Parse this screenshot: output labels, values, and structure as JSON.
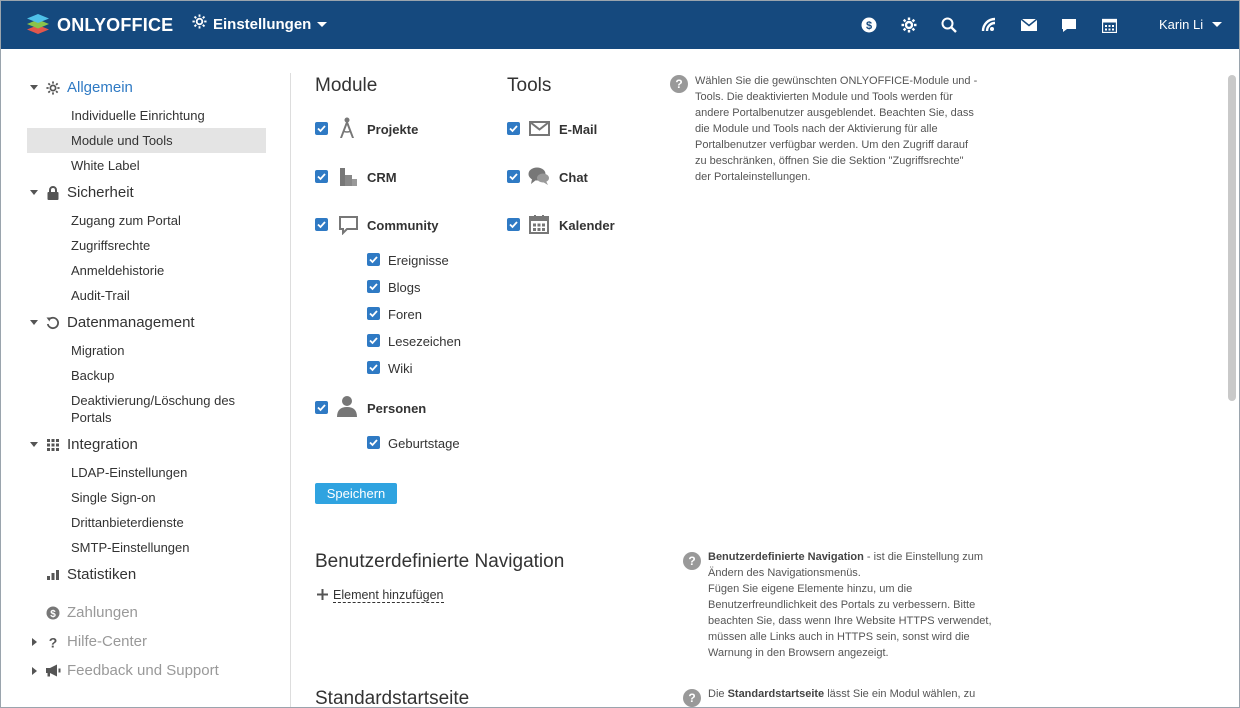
{
  "header": {
    "logo_text": "ONLYOFFICE",
    "module_label": "Einstellungen",
    "user_name": "Karin Li",
    "icons": [
      "payments-icon",
      "settings-icon",
      "search-icon",
      "feed-icon",
      "mail-icon",
      "chat-icon",
      "calendar-icon"
    ],
    "bg_color": "#15497e"
  },
  "sidebar": {
    "sections": {
      "allgemein": "Allgemein",
      "sicherheit": "Sicherheit",
      "datenmanagement": "Datenmanagement",
      "integration": "Integration",
      "statistiken": "Statistiken",
      "zahlungen": "Zahlungen",
      "hilfe": "Hilfe-Center",
      "feedback": "Feedback und Support"
    },
    "allgemein_items": [
      "Individuelle Einrichtung",
      "Module und Tools",
      "White Label"
    ],
    "sicherheit_items": [
      "Zugang zum Portal",
      "Zugriffsrechte",
      "Anmeldehistorie",
      "Audit-Trail"
    ],
    "datenmanagement_items": [
      "Migration",
      "Backup",
      "Deaktivierung/Löschung des",
      "Portals"
    ],
    "integration_items": [
      "LDAP-Einstellungen",
      "Single Sign-on",
      "Drittanbieterdienste",
      "SMTP-Einstellungen"
    ],
    "active_item": "Module und Tools",
    "accent_color": "#2f7ac4"
  },
  "main": {
    "modules_title": "Module",
    "tools_title": "Tools",
    "modules": {
      "projekte": "Projekte",
      "crm": "CRM",
      "community": "Community",
      "personen": "Personen"
    },
    "community_subs": [
      "Ereignisse",
      "Blogs",
      "Foren",
      "Lesezeichen",
      "Wiki"
    ],
    "personen_subs": [
      "Geburtstage"
    ],
    "tools": {
      "email": "E-Mail",
      "chat": "Chat",
      "kalender": "Kalender"
    },
    "save_label": "Speichern",
    "help_modules": [
      "Wählen Sie die gewünschten ONLYOFFICE-Module und -",
      "Tools. Die deaktivierten Module und Tools werden für",
      "andere Portalbenutzer ausgeblendet. Beachten Sie, dass",
      "die Module und Tools nach der Aktivierung für alle",
      "Portalbenutzer verfügbar werden. Um den Zugriff darauf",
      "zu beschränken, öffnen Sie die Sektion \"Zugriffsrechte\"",
      "der Portaleinstellungen."
    ],
    "nav_title": "Benutzerdefinierte Navigation",
    "add_element": "Element hinzufügen",
    "help_nav_bold": "Benutzerdefinierte Navigation",
    "help_nav_rest": " - ist die Einstellung zum",
    "help_nav_lines": [
      "Ändern des Navigationsmenüs.",
      "Fügen Sie eigene Elemente hinzu, um die",
      "Benutzerfreundlichkeit des Portals zu verbessern. Bitte",
      "beachten Sie, dass wenn Ihre Website HTTPS verwendet,",
      "müssen alle Links auch in HTTPS sein, sonst wird die",
      "Warnung in den Browsern angezeigt."
    ],
    "start_title": "Standardstartseite",
    "help_start_pre": "Die ",
    "help_start_bold": "Standardstartseite",
    "help_start_rest": " lässt Sie ein Modul wählen, zu"
  }
}
